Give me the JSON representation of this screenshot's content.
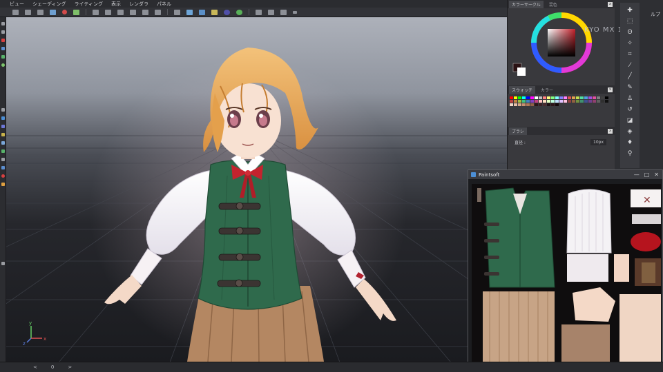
{
  "menubar": {
    "items": [
      "ビュー",
      "シェーディング",
      "ライティング",
      "表示",
      "レンダラ",
      "パネル"
    ]
  },
  "panels": {
    "color_circle": {
      "tabs": [
        "カラーサークル",
        "混色"
      ]
    },
    "swatch": {
      "tabs": [
        "スウォッチ",
        "カラー"
      ]
    },
    "brush": {
      "title": "ブラシ",
      "size_label": "直径 :",
      "size_value": "10px"
    }
  },
  "right_strip": {
    "text_partial": "ルプ"
  },
  "watermark": "KYO MX 1",
  "paintsoft_window": {
    "title": "Paintsoft",
    "controls": [
      "—",
      "□",
      "✕"
    ]
  },
  "statusbar": {
    "items": [
      "<",
      "0",
      ">"
    ]
  },
  "axis_gizmo": {
    "x": "x",
    "y": "y",
    "z": "z"
  },
  "colors": {
    "vest_green": "#2f6a4c",
    "hair": "#e8a94e",
    "ribbon": "#c4232e",
    "skirt": "#b48762",
    "accent_blue": "#4c8fd6"
  },
  "icons": {
    "left_tools": [
      "move-icon",
      "select-icon",
      "pen-icon",
      "brush-icon",
      "shape-icon",
      "circle-icon",
      "eraser-icon",
      "fill-icon",
      "text-icon",
      "gradient-icon",
      "eyedropper-icon",
      "zoom-icon"
    ],
    "right_tools": [
      "move-icon",
      "marquee-icon",
      "lasso-icon",
      "magic-wand-icon",
      "crop-icon",
      "eyedropper-icon",
      "brush-icon",
      "pencil-icon",
      "stamp-icon",
      "history-brush-icon",
      "eraser-icon",
      "bucket-icon",
      "blur-icon",
      "dodge-icon"
    ]
  }
}
